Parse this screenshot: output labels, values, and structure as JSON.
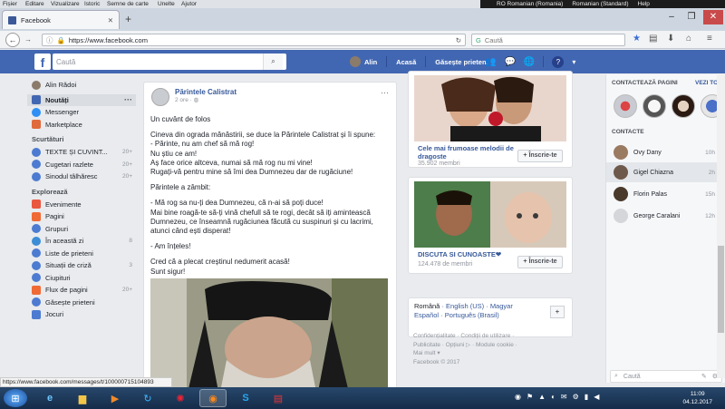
{
  "menubar": {
    "items": [
      "Fișier",
      "Editare",
      "Vizualizare",
      "Istoric",
      "Semne de carte",
      "Unelte",
      "Ajutor"
    ]
  },
  "system_status": {
    "lang1": "RO Romanian (Romania)",
    "lang2": "Romanian (Standard)",
    "help": "Help"
  },
  "browser": {
    "tab_title": "Facebook",
    "url": "https://www.facebook.com",
    "search_placeholder": "Caută"
  },
  "fb": {
    "search_placeholder": "Caută",
    "nav": {
      "user": "Alin",
      "home": "Acasă",
      "find_friends": "Găsește prieteni"
    }
  },
  "left": {
    "user": "Alin Rădoi",
    "items": [
      {
        "label": "Noutăți",
        "icon": "news-feed-icon"
      },
      {
        "label": "Messenger",
        "icon": "messenger-icon"
      },
      {
        "label": "Marketplace",
        "icon": "marketplace-icon"
      }
    ],
    "shortcuts_title": "Scurtături",
    "shortcuts": [
      {
        "label": "TEXTE ȘI CUVINT...",
        "count": "20+"
      },
      {
        "label": "Cugetari razlete",
        "count": "20+"
      },
      {
        "label": "Sinodul tâlhăresc",
        "count": "20+"
      }
    ],
    "explore_title": "Explorează",
    "explore": [
      {
        "label": "Evenimente",
        "count": ""
      },
      {
        "label": "Pagini",
        "count": ""
      },
      {
        "label": "Grupuri",
        "count": ""
      },
      {
        "label": "În această zi",
        "count": "8"
      },
      {
        "label": "Liste de prieteni",
        "count": ""
      },
      {
        "label": "Situații de criză",
        "count": "3"
      },
      {
        "label": "Ciupituri",
        "count": ""
      },
      {
        "label": "Flux de pagini",
        "count": "20+"
      },
      {
        "label": "Găsește prieteni",
        "count": ""
      },
      {
        "label": "Jocuri",
        "count": ""
      }
    ]
  },
  "post": {
    "author": "Părintele Calistrat",
    "time": "2 ore · ",
    "paragraphs": [
      "Un cuvânt de folos",
      "Cineva din ograda mănăstirii, se duce la Părintele Calistrat și îi spune:\n- Părinte, nu am chef să mă rog!\nNu știu ce am!\nAș face orice altceva, numai să mă rog nu mi vine!\nRugați-vă pentru mine să îmi dea Dumnezeu dar de rugăciune!",
      "Părintele a zâmbit:",
      "- Mă rog sa nu-ți dea Dumnezeu, că n-ai să poți duce!\nMai bine roagă-te să-ți vină chefull să te rogi, decât să iți amintească Dumnezeu, ce înseamnă rugăciunea făcută cu suspinuri și cu lacrimi, atunci când ești disperat!",
      "- Am înțeles!",
      "Cred că a plecat creștinul nedumerit acasă!\nSunt sigur!"
    ]
  },
  "groups": [
    {
      "title": "Cele mai frumoase melodii de dragoste",
      "members": "35.902 membri",
      "join": "+ Înscrie-te"
    },
    {
      "title": "DISCUTA SI CUNOASTE❤",
      "members": "124.478 de membri",
      "join": "+ Înscrie-te"
    }
  ],
  "languages": {
    "line1": [
      "Română",
      "English (US)",
      "Magyar"
    ],
    "line2": [
      "Español",
      "Português (Brasil)"
    ],
    "plus": "+"
  },
  "footer": {
    "lines": [
      "Confidențialitate · Condiții de utilizare ·",
      "Publicitate · Opțiuni ▷ · Module cookie ·",
      "Mai mult ▾",
      "Facebook © 2017"
    ]
  },
  "right": {
    "contact_pages": "CONTACTEAZĂ PAGINI",
    "see_all": "VEZI TOT",
    "contacts_title": "CONTACTE",
    "contacts": [
      {
        "name": "Ovy Dany",
        "time": "10h"
      },
      {
        "name": "Gigel Chiazna",
        "time": "2h"
      },
      {
        "name": "Florin Palas",
        "time": "15h"
      },
      {
        "name": "George Caralani",
        "time": "12h"
      }
    ],
    "search_placeholder": "Caută"
  },
  "status_url": "https://www.facebook.com/messages/t/100000715104893",
  "clock": {
    "time": "11:09",
    "date": "04.12.2017"
  }
}
